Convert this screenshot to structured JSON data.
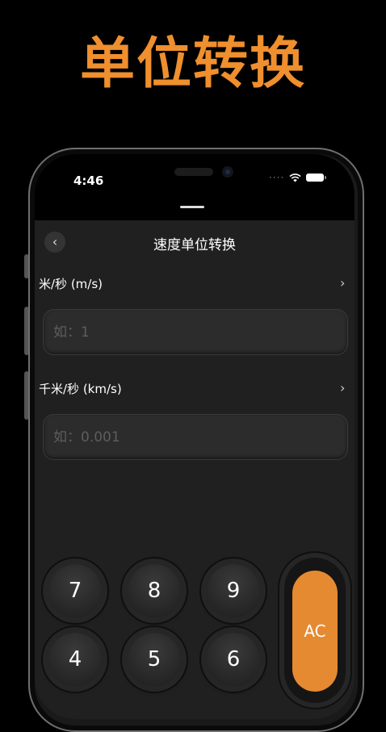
{
  "headline": "单位转换",
  "status": {
    "time": "4:46",
    "signal": "····"
  },
  "nav": {
    "title": "速度单位转换"
  },
  "units": [
    {
      "label": "米/秒 (m/s)",
      "placeholder": "如：1",
      "value": ""
    },
    {
      "label": "千米/秒 (km/s)",
      "placeholder": "如：0.001",
      "value": ""
    }
  ],
  "keypad": {
    "row1": [
      "7",
      "8",
      "9"
    ],
    "row2": [
      "4",
      "5",
      "6"
    ],
    "clear": "AC"
  },
  "colors": {
    "accent": "#e58a31",
    "headline": "#ef8f2e",
    "sheet": "#202020"
  }
}
